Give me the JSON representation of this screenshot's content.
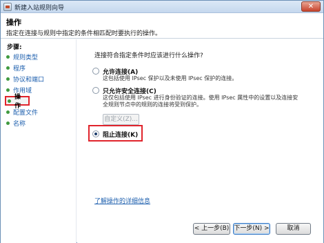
{
  "window": {
    "title": "新建入站规则向导",
    "close_label": "✕"
  },
  "header": {
    "title": "操作",
    "description": "指定在连接与规则中指定的条件相匹配时要执行的操作。"
  },
  "sidebar": {
    "title": "步骤:",
    "items": [
      {
        "label": "规则类型",
        "active": false
      },
      {
        "label": "程序",
        "active": false
      },
      {
        "label": "协议和端口",
        "active": false
      },
      {
        "label": "作用域",
        "active": false
      },
      {
        "label": "操作",
        "active": true
      },
      {
        "label": "配置文件",
        "active": false
      },
      {
        "label": "名称",
        "active": false
      }
    ]
  },
  "main": {
    "question": "连接符合指定条件时应该进行什么操作?",
    "options": [
      {
        "label": "允许连接(A)",
        "description": [
          "这包括使用 IPsec 保护以及未使用 IPsec 保护的连接。"
        ],
        "selected": false
      },
      {
        "label": "只允许安全连接(C)",
        "description": [
          "这仅包括使用 IPsec 进行身份验证的连接。使用 IPsec 属性中的设置以及连接安",
          "全规则节点中的规则的连接将受到保护。"
        ],
        "selected": false
      },
      {
        "label": "阻止连接(K)",
        "description": [],
        "selected": true
      }
    ],
    "customize_label": "自定义(Z)...",
    "help_link": "了解操作的详细信息"
  },
  "buttons": {
    "back": "< 上一步(B)",
    "next": "下一步(N) >",
    "cancel": "取消"
  },
  "colors": {
    "highlight_border": "#e0232b",
    "link": "#1d5fae",
    "title_bar": "#c5d8ee"
  }
}
